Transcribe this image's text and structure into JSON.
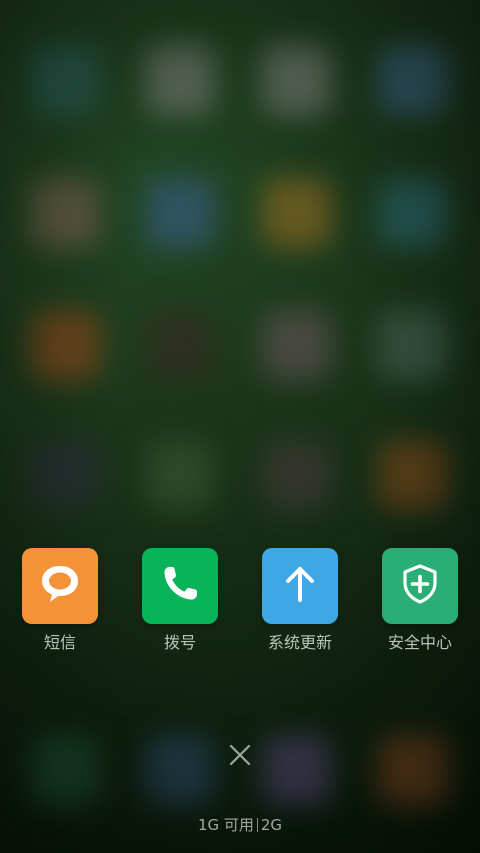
{
  "recent_apps": [
    {
      "label": "短信",
      "icon": "message-bubble-icon",
      "color": "#F39237"
    },
    {
      "label": "拨号",
      "icon": "phone-icon",
      "color": "#08B35A"
    },
    {
      "label": "系统更新",
      "icon": "arrow-up-icon",
      "color": "#3EA8E5"
    },
    {
      "label": "安全中心",
      "icon": "shield-plus-icon",
      "color": "#2BAE75"
    }
  ],
  "close_icon": "close-icon",
  "memory": {
    "available": "1G 可用",
    "total": "2G"
  }
}
